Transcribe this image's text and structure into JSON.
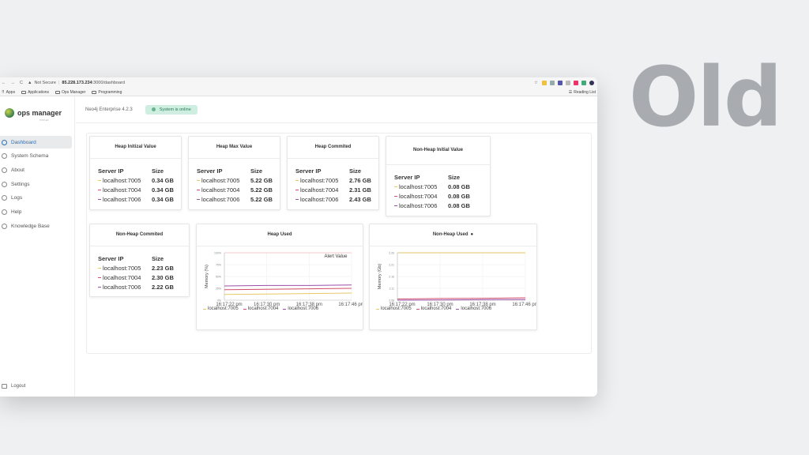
{
  "overlay_label": "Old",
  "browser": {
    "security": "Not Secure",
    "url_host": "85.228.173.234",
    "url_path": ":3000/dashboard",
    "bookmarks": [
      "Apps",
      "Applications",
      "Ops Manager",
      "Programming"
    ],
    "reading_list": "Reading List"
  },
  "sidebar": {
    "brand": "ops manager",
    "items": [
      {
        "label": "Dashboard",
        "icon": "home-icon"
      },
      {
        "label": "System Schema",
        "icon": "database-icon"
      },
      {
        "label": "About",
        "icon": "info-icon"
      },
      {
        "label": "Settings",
        "icon": "gear-icon"
      },
      {
        "label": "Logs",
        "icon": "clipboard-icon"
      },
      {
        "label": "Help",
        "icon": "help-icon"
      },
      {
        "label": "Knowledge Base",
        "icon": "book-icon"
      }
    ],
    "logout": "Logout"
  },
  "header": {
    "version": "Neo4j Enterprise 4.2.3",
    "status": "System is online"
  },
  "colors": {
    "s7005": "#e6c76a",
    "s7004": "#d2506b",
    "s7006": "#9a4fa8",
    "status_bg": "#cdeee0"
  },
  "tables": {
    "heap_initial": {
      "title": "Heap Initizal Value",
      "col_ip": "Server IP",
      "col_size": "Size",
      "rows": [
        {
          "ip": "localhost:7005",
          "size": "0.34 GB"
        },
        {
          "ip": "localhost:7004",
          "size": "0.34 GB"
        },
        {
          "ip": "localhost:7006",
          "size": "0.34 GB"
        }
      ]
    },
    "heap_max": {
      "title": "Heap Max Value",
      "col_ip": "Server IP",
      "col_size": "Size",
      "rows": [
        {
          "ip": "localhost:7005",
          "size": "5.22 GB"
        },
        {
          "ip": "localhost:7004",
          "size": "5.22 GB"
        },
        {
          "ip": "localhost:7006",
          "size": "5.22 GB"
        }
      ]
    },
    "heap_commited": {
      "title": "Heap Commited",
      "col_ip": "Server IP",
      "col_size": "Size",
      "rows": [
        {
          "ip": "localhost:7005",
          "size": "2.76 GB"
        },
        {
          "ip": "localhost:7004",
          "size": "2.31 GB"
        },
        {
          "ip": "localhost:7006",
          "size": "2.43 GB"
        }
      ]
    },
    "nonheap_initial": {
      "title": "Non-Heap Initial Value",
      "col_ip": "Server IP",
      "col_size": "Size",
      "rows": [
        {
          "ip": "localhost:7005",
          "size": "0.08 GB"
        },
        {
          "ip": "localhost:7004",
          "size": "0.08 GB"
        },
        {
          "ip": "localhost:7006",
          "size": "0.08 GB"
        }
      ]
    },
    "nonheap_commited": {
      "title": "Non-Heap Commited",
      "col_ip": "Server IP",
      "col_size": "Size",
      "rows": [
        {
          "ip": "localhost:7005",
          "size": "2.23 GB"
        },
        {
          "ip": "localhost:7004",
          "size": "2.30 GB"
        },
        {
          "ip": "localhost:7006",
          "size": "2.22 GB"
        }
      ]
    }
  },
  "heap_used": {
    "title": "Heap Used",
    "ylabel": "Memory (%)",
    "annotation": "Alert Value",
    "legend": [
      "localhost:7005",
      "localhost:7004",
      "localhost:7006"
    ]
  },
  "nonheap_used": {
    "title": "Non-Heap Used",
    "ylabel": "Memory (Gb)",
    "legend": [
      "localhost:7005",
      "localhost:7004",
      "localhost:7006"
    ]
  },
  "chart_data": [
    {
      "type": "line",
      "title": "Heap Used",
      "ylabel": "Memory (%)",
      "x": [
        "16:17:22 pm",
        "16:17:30 pm",
        "16:17:38 pm",
        "16:17:46 pm"
      ],
      "yticks": [
        "0%",
        "25%",
        "50%",
        "75%",
        "100%"
      ],
      "ylim": [
        0,
        100
      ],
      "threshold": 100,
      "series": [
        {
          "name": "localhost:7005",
          "values": [
            12,
            13,
            14,
            15
          ]
        },
        {
          "name": "localhost:7004",
          "values": [
            22,
            23,
            24,
            25
          ]
        },
        {
          "name": "localhost:7006",
          "values": [
            30,
            31,
            31,
            32
          ]
        }
      ]
    },
    {
      "type": "line",
      "title": "Non-Heap Used",
      "ylabel": "Memory (Gb)",
      "x": [
        "16:17:22 pm",
        "16:17:30 pm",
        "16:17:38 pm",
        "16:17:46 pm"
      ],
      "yticks": [
        "2.06",
        "2.11",
        "2.16",
        "2.21",
        "2.26"
      ],
      "ylim": [
        2.06,
        2.26
      ],
      "series": [
        {
          "name": "localhost:7005",
          "values": [
            2.26,
            2.26,
            2.26,
            2.26
          ]
        },
        {
          "name": "localhost:7004",
          "values": [
            2.065,
            2.067,
            2.068,
            2.07
          ]
        },
        {
          "name": "localhost:7006",
          "values": [
            2.06,
            2.061,
            2.062,
            2.063
          ]
        }
      ]
    }
  ]
}
